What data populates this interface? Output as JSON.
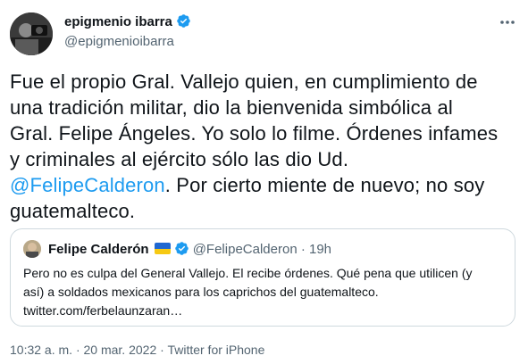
{
  "author": {
    "name": "epigmenio ibarra",
    "handle": "@epigmenioibarra",
    "verified_icon": "verified-badge-icon",
    "more_icon": "more-options-icon"
  },
  "tweet": {
    "line1": "Fue el propio Gral. Vallejo quien, en cumplimiento de",
    "line2": "una tradición militar, dio la bienvenida simbólica al",
    "line3": "Gral. Felipe Ángeles. Yo solo lo filme. Órdenes infames",
    "line4": "y criminales al ejército sólo las dio Ud.",
    "mention": "@FelipeCalderon",
    "line5_rest": ". Por cierto miente de nuevo; no soy",
    "line6": "guatemalteco."
  },
  "quoted": {
    "name": "Felipe Calderón",
    "flag_icon": "ukraine-flag-icon",
    "handle": "@FelipeCalderon",
    "separator": "·",
    "time": "19h",
    "line1": "Pero no es culpa del General Vallejo. El recibe órdenes. Qué pena que utilicen (y",
    "line2": "así) a soldados mexicanos para los caprichos del guatemalteco.",
    "line3": "twitter.com/ferbelaunzaran…"
  },
  "meta": {
    "time": "10:32 a. m.",
    "sep1": "·",
    "date": "20 mar. 2022",
    "sep2": "·",
    "source": "Twitter for iPhone"
  },
  "colors": {
    "link": "#1d9bf0",
    "secondary_text": "#536471",
    "border": "#cfd9de",
    "verified": "#1d9bf0"
  }
}
